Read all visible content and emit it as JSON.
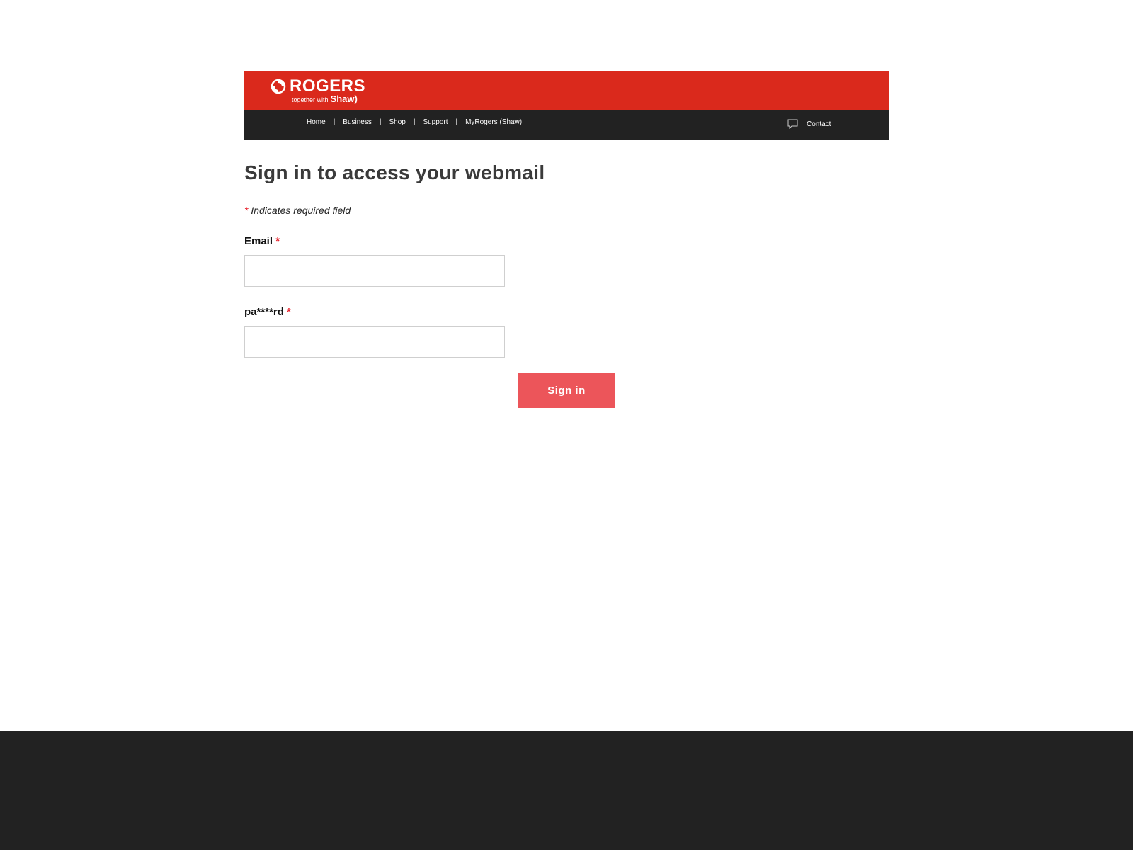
{
  "header": {
    "logo_word": "ROGERS",
    "logo_tagline": "together with",
    "logo_partner": "Shaw)",
    "nav": [
      {
        "label": "Home"
      },
      {
        "label": "Business"
      },
      {
        "label": "Shop"
      },
      {
        "label": "Support"
      },
      {
        "label": "MyRogers (Shaw)"
      }
    ],
    "nav_separator": "|",
    "contact_label": "Contact"
  },
  "form": {
    "title": "Sign in to access your webmail",
    "required_marker": "*",
    "required_note": "Indicates required field",
    "email_label": "Email",
    "email_value": "",
    "password_label": "pa****rd",
    "password_value": "",
    "submit_label": "Sign in"
  },
  "colors": {
    "brand_red": "#da291c",
    "header_dark": "#222222",
    "button": "#ec555a",
    "required_star": "#e8242e",
    "footer": "#222222"
  },
  "icons": {
    "logo": "rogers-logo-icon",
    "contact": "chat-bubble-icon"
  }
}
